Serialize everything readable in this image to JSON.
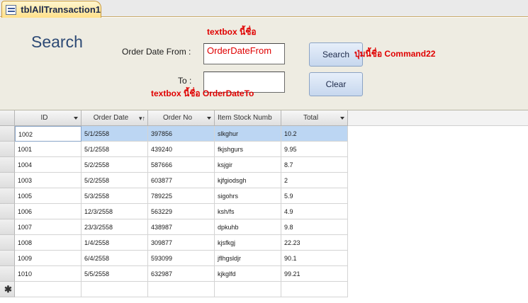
{
  "tab": {
    "label": "tblAllTransaction1",
    "icon": "form-icon"
  },
  "form": {
    "title": "Search",
    "order_date_from_label": "Order Date From :",
    "to_label": "To :",
    "order_date_from_value": "OrderDateFrom",
    "order_date_to_value": "",
    "search_button": "Search",
    "clear_button": "Clear"
  },
  "annotations": {
    "textbox_from": "textbox นี้ชื่อ",
    "button_name": "ปุ่มนี้ชื่อ   Command22",
    "textbox_to": "textbox นี้ชื่อ   OrderDateTo"
  },
  "table": {
    "columns": [
      "ID",
      "Order Date",
      "Order No",
      "Item Stock Numb",
      "Total"
    ],
    "rows": [
      [
        "1002",
        "5/1/2558",
        "397856",
        "slkghur",
        "10.2"
      ],
      [
        "1001",
        "5/1/2558",
        "439240",
        "fkjshgurs",
        "9.95"
      ],
      [
        "1004",
        "5/2/2558",
        "587666",
        "ksjgir",
        "8.7"
      ],
      [
        "1003",
        "5/2/2558",
        "603877",
        "kjfgiodsgh",
        "2"
      ],
      [
        "1005",
        "5/3/2558",
        "789225",
        "sigohrs",
        "5.9"
      ],
      [
        "1006",
        "12/3/2558",
        "563229",
        "ksh/fs",
        "4.9"
      ],
      [
        "1007",
        "23/3/2558",
        "438987",
        "dpkuhb",
        "9.8"
      ],
      [
        "1008",
        "1/4/2558",
        "309877",
        "kjsfkgj",
        "22.23"
      ],
      [
        "1009",
        "6/4/2558",
        "593099",
        "jflhgsldjr",
        "90.1"
      ],
      [
        "1010",
        "5/5/2558",
        "632987",
        "kjkglfd",
        "99.21"
      ]
    ],
    "new_record_marker": "✱",
    "selected_row_index": 0
  }
}
